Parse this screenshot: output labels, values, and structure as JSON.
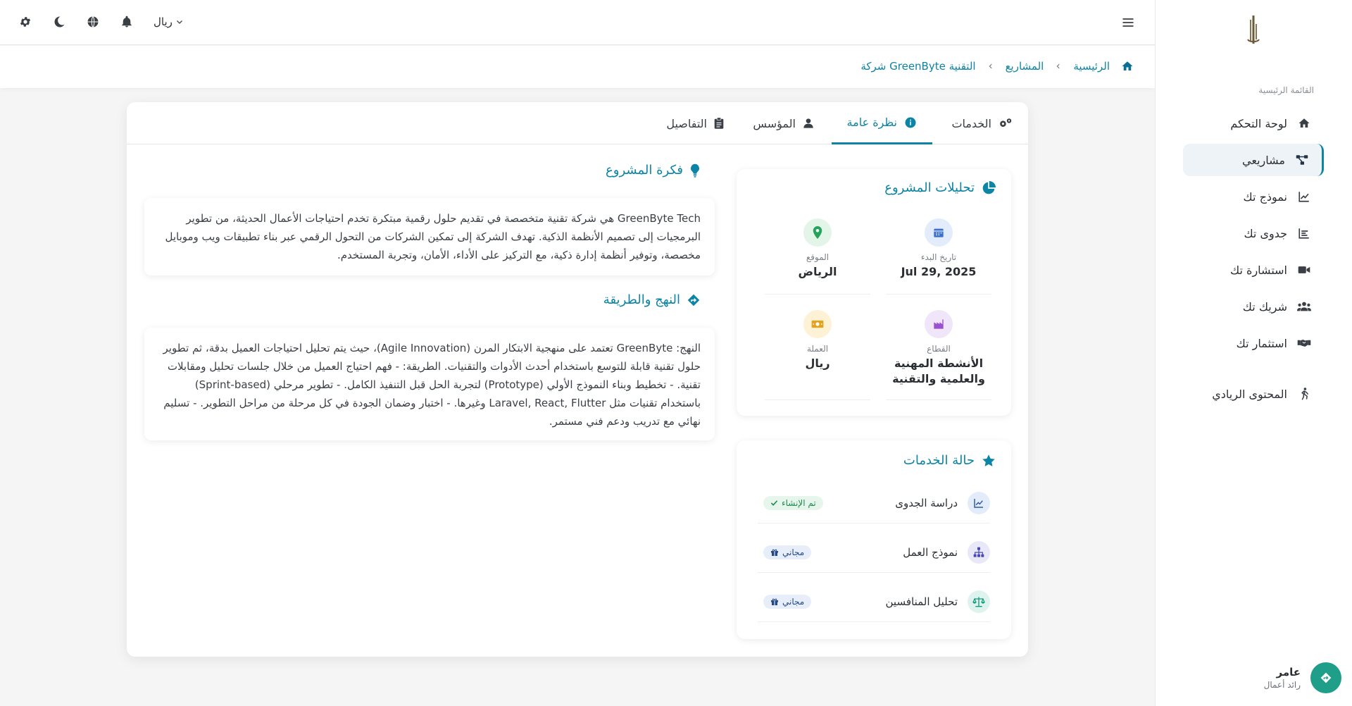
{
  "topbar": {
    "currency": "ريال",
    "icons": [
      "gear-icon",
      "moon-icon",
      "globe-icon",
      "bell-icon",
      "chevron-down-icon",
      "hamburger-icon"
    ]
  },
  "sidebar": {
    "menu_title": "القائمة الرئيسية",
    "items": [
      {
        "label": "لوحة التحكم",
        "icon": "home-icon"
      },
      {
        "label": "مشاريعي",
        "icon": "project-diagram-icon",
        "active": true
      },
      {
        "label": "نموذج تك",
        "icon": "chart-line-icon"
      },
      {
        "label": "جدوى تك",
        "icon": "chart-bars-icon"
      },
      {
        "label": "استشارة تك",
        "icon": "video-icon"
      },
      {
        "label": "شريك تك",
        "icon": "users-icon"
      },
      {
        "label": "استثمار تك",
        "icon": "handshake-icon"
      },
      {
        "label": "المحتوى الريادي",
        "icon": "person-running-icon"
      }
    ],
    "user": {
      "name": "عامر",
      "role": "رائد أعمال"
    }
  },
  "breadcrumb": {
    "home": "الرئيسية",
    "projects": "المشاريع",
    "current": "شركة GreenByte التقنية"
  },
  "tabs": [
    {
      "label": "الخدمات",
      "icon": "gears-icon"
    },
    {
      "label": "نظرة عامة",
      "icon": "info-circle-icon",
      "active": true
    },
    {
      "label": "المؤسس",
      "icon": "user-icon"
    },
    {
      "label": "التفاصيل",
      "icon": "clipboard-icon"
    }
  ],
  "analytics": {
    "title": "تحليلات المشروع",
    "stats": {
      "start_date": {
        "label": "تاريخ البدء",
        "value": "Jul 29, 2025"
      },
      "location": {
        "label": "الموقع",
        "value": "الرياض"
      },
      "sector": {
        "label": "القطاع",
        "value": "الأنشطة المهنية والعلمية والتقنية"
      },
      "currency": {
        "label": "العملة",
        "value": "ريال"
      }
    }
  },
  "services": {
    "title": "حالة الخدمات",
    "rows": [
      {
        "name": "دراسة الجدوى",
        "badge": "تم الإنشاء",
        "status": "done"
      },
      {
        "name": "نموذج العمل",
        "badge": "مجاني",
        "status": "free"
      },
      {
        "name": "تحليل المنافسين",
        "badge": "مجاني",
        "status": "free"
      }
    ]
  },
  "idea": {
    "title": "فكرة المشروع",
    "text": "GreenByte Tech هي شركة تقنية متخصصة في تقديم حلول رقمية مبتكرة تخدم احتياجات الأعمال الحديثة، من تطوير البرمجيات إلى تصميم الأنظمة الذكية. تهدف الشركة إلى تمكين الشركات من التحول الرقمي عبر بناء تطبيقات ويب وموبايل مخصصة، وتوفير أنظمة إدارة ذكية، مع التركيز على الأداء، الأمان، وتجربة المستخدم."
  },
  "approach": {
    "title": "النهج والطريقة",
    "text": "النهج: GreenByte تعتمد على منهجية الابتكار المرن (Agile Innovation)، حيث يتم تحليل احتياجات العميل بدقة، ثم تطوير حلول تقنية قابلة للتوسع باستخدام أحدث الأدوات والتقنيات. الطريقة: - فهم احتياج العميل من خلال جلسات تحليل ومقابلات تقنية. - تخطيط وبناء النموذج الأولي (Prototype) لتجربة الحل قبل التنفيذ الكامل. - تطوير مرحلي (Sprint-based) باستخدام تقنيات مثل Laravel, React, Flutter وغيرها. - اختبار وضمان الجودة في كل مرحلة من مراحل التطوير. - تسليم نهائي مع تدريب ودعم فني مستمر."
  },
  "colors": {
    "accent": "#0b84a5",
    "success": "#1f8a4c",
    "free": "#234a86"
  }
}
